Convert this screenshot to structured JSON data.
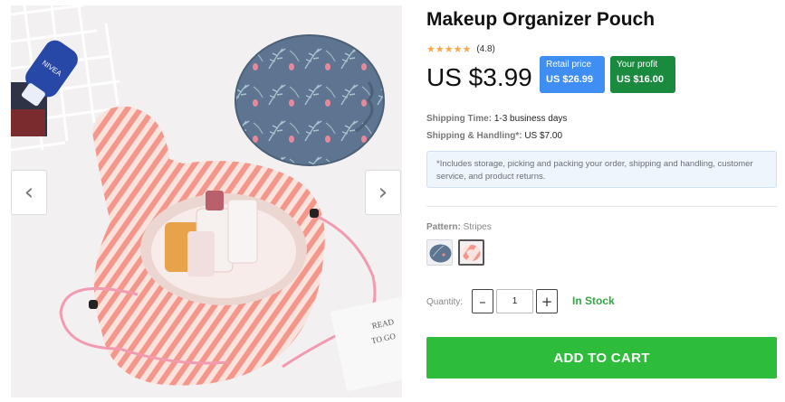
{
  "product": {
    "title": "Makeup Organizer Pouch",
    "rating": "(4.8)",
    "stars": "★★★★★",
    "price": "US $3.99"
  },
  "badges": {
    "retail_label": "Retail price",
    "retail_value": "US $26.99",
    "profit_label": "Your profit",
    "profit_value": "US $16.00"
  },
  "shipping": {
    "time_label": "Shipping Time:",
    "time_value": "1-3 business days",
    "handling_label": "Shipping & Handling*:",
    "handling_value": "US $7.00",
    "notice": "*Includes storage, picking and packing your order, shipping and handling, customer service, and product returns."
  },
  "pattern": {
    "label": "Pattern:",
    "value": "Stripes"
  },
  "quantity": {
    "label": "Quantity:",
    "minus": "–",
    "plus": "+",
    "value": "1"
  },
  "stock_status": "In Stock",
  "add_to_cart": "ADD TO CART",
  "gallery": {
    "prev_icon": "‹",
    "next_icon": "›",
    "card_text_1": "READ",
    "card_text_2": "TO GO"
  },
  "colors": {
    "retail_badge": "#3e8ef4",
    "profit_badge": "#198a3e",
    "in_stock": "#34a845",
    "add_to_cart": "#2dbd3a",
    "stars": "#f6a94a"
  }
}
